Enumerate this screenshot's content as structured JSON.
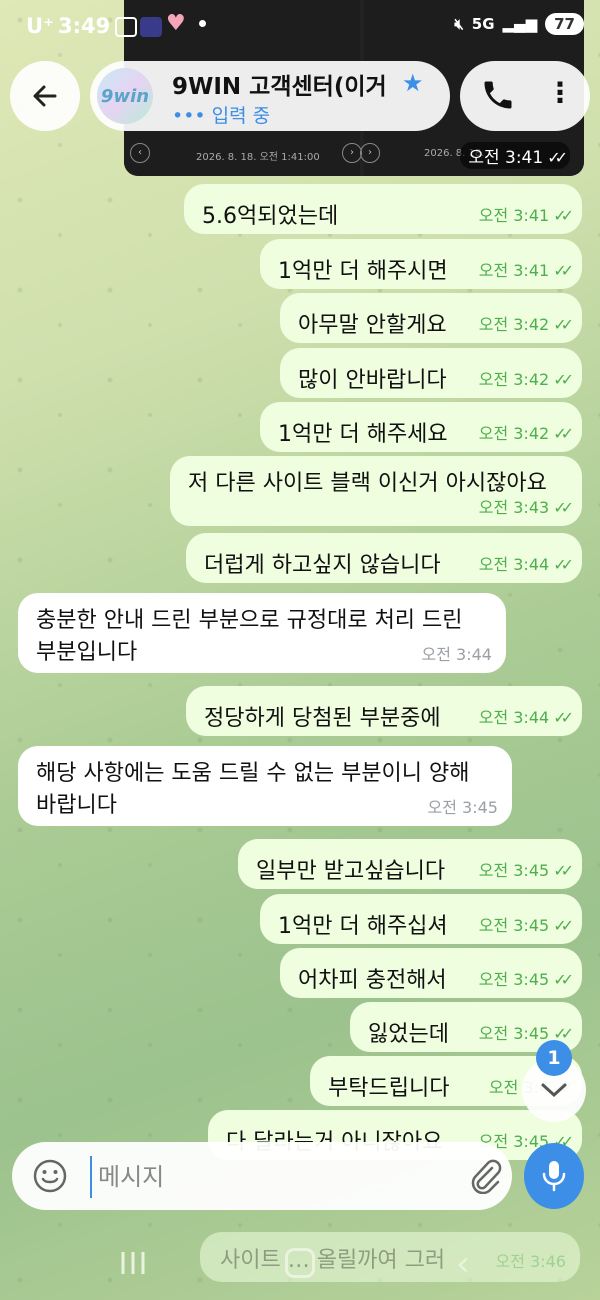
{
  "status_bar": {
    "carrier": "U⁺",
    "time": "3:49",
    "network": "5G",
    "battery": "77"
  },
  "header": {
    "title": "9WIN 고객센터(이거",
    "status": "••• 입력 중",
    "avatar_text": "9win"
  },
  "images": {
    "left_date": "2026. 8. 18. 오전 1:41:00",
    "right_date": "2026. 8. 18.",
    "time": "오전 3:41"
  },
  "messages": [
    {
      "dir": "out",
      "text": "5.6억되었는데",
      "time": "오전 3:41"
    },
    {
      "dir": "out",
      "text": "1억만 더 해주시면",
      "time": "오전 3:41"
    },
    {
      "dir": "out",
      "text": "아무말 안할게요",
      "time": "오전 3:42"
    },
    {
      "dir": "out",
      "text": "많이 안바랍니다",
      "time": "오전 3:42"
    },
    {
      "dir": "out",
      "text": "1억만 더 해주세요",
      "time": "오전 3:42"
    },
    {
      "dir": "out",
      "text": "저 다른 사이트 블랙 이신거 아시잖아요",
      "time": "오전 3:43"
    },
    {
      "dir": "out",
      "text": "더럽게 하고싶지 않습니다",
      "time": "오전 3:44"
    },
    {
      "dir": "in",
      "text": "충분한 안내 드린 부분으로 규정대로 처리 드린 부분입니다",
      "time": "오전 3:44"
    },
    {
      "dir": "out",
      "text": "정당하게 당첨된 부분중에",
      "time": "오전 3:44"
    },
    {
      "dir": "in",
      "text": "해당 사항에는 도움 드릴 수 없는 부분이니 양해 바랍니다",
      "time": "오전 3:45"
    },
    {
      "dir": "out",
      "text": "일부만 받고싶습니다",
      "time": "오전 3:45"
    },
    {
      "dir": "out",
      "text": "1억만 더 해주십셔",
      "time": "오전 3:45"
    },
    {
      "dir": "out",
      "text": "어차피 충전해서",
      "time": "오전 3:45"
    },
    {
      "dir": "out",
      "text": "잃었는데",
      "time": "오전 3:45"
    },
    {
      "dir": "out",
      "text": "부탁드립니다",
      "time": "오전 3:4"
    },
    {
      "dir": "out",
      "text": "다 달라는거 아니잖아요",
      "time": "오전 3:45"
    }
  ],
  "ghost_message": {
    "text": "사이트 … 올릴까여 그러",
    "time": "오전 3:46"
  },
  "scroll": {
    "unread_count": "1"
  },
  "composer": {
    "placeholder": "메시지"
  },
  "colors": {
    "accent": "#3c8ee6",
    "outgoing_bubble": "#eefedf",
    "check": "#4fae4e"
  }
}
